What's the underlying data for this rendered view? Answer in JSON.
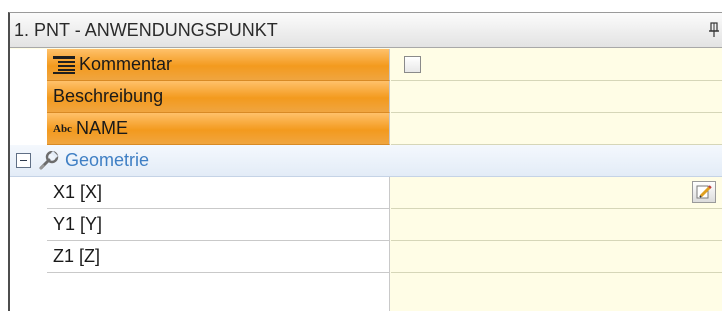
{
  "panel": {
    "title": "1. PNT - ANWENDUNGSPUNKT",
    "pin_icon": "pin-icon"
  },
  "rows": {
    "kommentar": {
      "label": "Kommentar",
      "icon": "list-icon",
      "checked": false
    },
    "beschreibung": {
      "label": "Beschreibung",
      "value": ""
    },
    "name": {
      "label": "NAME",
      "icon_text": "Abc",
      "value": ""
    }
  },
  "group": {
    "label": "Geometrie",
    "icon": "wrench-icon",
    "expanded": true
  },
  "geometry": {
    "x1": {
      "label": "X1 [X]",
      "value": ""
    },
    "y1": {
      "label": "Y1 [Y]",
      "value": ""
    },
    "z1": {
      "label": "Z1 [Z]",
      "value": ""
    }
  },
  "colors": {
    "orange_row": "#f39a1e",
    "value_bg": "#fffde6",
    "group_text": "#3f7fc4"
  }
}
